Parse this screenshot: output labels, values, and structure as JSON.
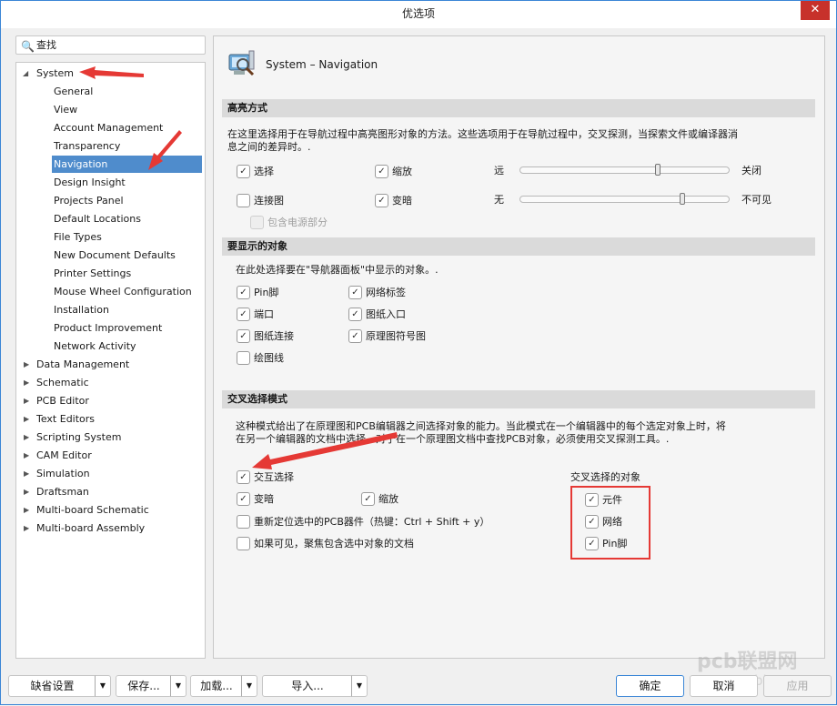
{
  "window": {
    "title": "优选项",
    "close_icon": "close-icon"
  },
  "search": {
    "placeholder": "查找"
  },
  "tree": {
    "system": "System",
    "children": [
      "General",
      "View",
      "Account Management",
      "Transparency",
      "Navigation",
      "Design Insight",
      "Projects Panel",
      "Default Locations",
      "File Types",
      "New Document Defaults",
      "Printer Settings",
      "Mouse Wheel Configuration",
      "Installation",
      "Product Improvement",
      "Network Activity"
    ],
    "selected": "Navigation",
    "top": [
      "Data Management",
      "Schematic",
      "PCB Editor",
      "Text Editors",
      "Scripting System",
      "CAM Editor",
      "Simulation",
      "Draftsman",
      "Multi-board Schematic",
      "Multi-board Assembly"
    ]
  },
  "panel": {
    "title": "System – Navigation",
    "highlight": {
      "header": "高亮方式",
      "desc1": "在这里选择用于在导航过程中高亮图形对象的方法。这些选项用于在导航过程中，交叉探测，当探索文件或编译器消",
      "desc2": "息之间的差异时。.",
      "select": {
        "label": "选择",
        "checked": true
      },
      "zoom": {
        "label": "缩放",
        "checked": true
      },
      "connect": {
        "label": "连接图",
        "checked": false
      },
      "dim": {
        "label": "变暗",
        "checked": true
      },
      "power": {
        "label": "包含电源部分",
        "checked": false,
        "disabled": true
      },
      "zoom_slider": {
        "min_label": "远",
        "max_label": "关闭",
        "value": 0.67
      },
      "dim_slider": {
        "min_label": "无",
        "max_label": "不可见",
        "value": 0.79
      }
    },
    "objects": {
      "header": "要显示的对象",
      "desc": "在此处选择要在\"导航器面板\"中显示的对象。.",
      "items": [
        {
          "label": "Pin脚",
          "checked": true
        },
        {
          "label": "网络标签",
          "checked": true
        },
        {
          "label": "端口",
          "checked": true
        },
        {
          "label": "图纸入口",
          "checked": true
        },
        {
          "label": "图纸连接",
          "checked": true
        },
        {
          "label": "原理图符号图",
          "checked": true
        },
        {
          "label": "绘图线",
          "checked": false
        }
      ]
    },
    "cross": {
      "header": "交叉选择模式",
      "desc1": "这种模式给出了在原理图和PCB编辑器之间选择对象的能力。当此模式在一个编辑器中的每个选定对象上时，将",
      "desc2": "在另一个编辑器的文档中选择。对于在一个原理图文档中查找PCB对象，必须使用交叉探测工具。.",
      "cross_select": {
        "label": "交互选择",
        "checked": true
      },
      "dim": {
        "label": "变暗",
        "checked": true
      },
      "zoom": {
        "label": "缩放",
        "checked": true
      },
      "relocate": {
        "label": "重新定位选中的PCB器件（热键：Ctrl + Shift + y）",
        "checked": false
      },
      "focus": {
        "label": "如果可见，聚焦包含选中对象的文档",
        "checked": false
      },
      "objects_label": "交叉选择的对象",
      "objects": [
        {
          "label": "元件",
          "checked": true
        },
        {
          "label": "网络",
          "checked": true
        },
        {
          "label": "Pin脚",
          "checked": true
        }
      ]
    }
  },
  "footer": {
    "defaults": "缺省设置",
    "save": "保存...",
    "load": "加载...",
    "import": "导入...",
    "ok": "确定",
    "cancel": "取消",
    "apply": "应用"
  },
  "watermark": {
    "logo": "pcb联盟网",
    "url": "www.pcbbar.com"
  },
  "colors": {
    "selection": "#4f8ccc",
    "annotation": "#e53935",
    "window_border": "#3b86d6"
  }
}
